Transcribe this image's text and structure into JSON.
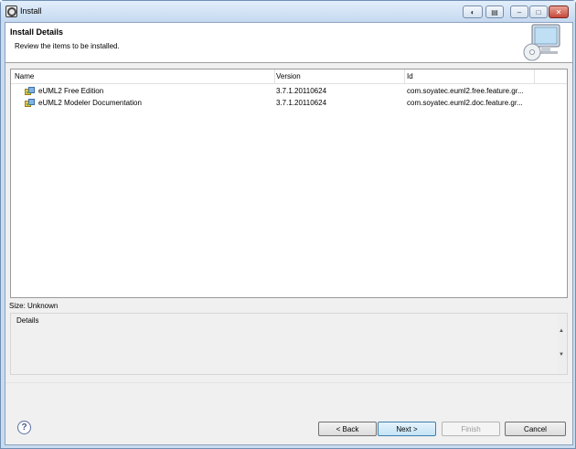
{
  "window": {
    "title": "Install"
  },
  "header": {
    "title": "Install Details",
    "subtitle": "Review the items to be installed."
  },
  "table": {
    "columns": [
      "Name",
      "Version",
      "Id"
    ],
    "rows": [
      {
        "name": "eUML2 Free Edition",
        "version": "3.7.1.20110624",
        "id": "com.soyatec.euml2.free.feature.gr..."
      },
      {
        "name": "eUML2 Modeler Documentation",
        "version": "3.7.1.20110624",
        "id": "com.soyatec.euml2.doc.feature.gr..."
      }
    ]
  },
  "size_text": "Size: Unknown",
  "details": {
    "label": "Details"
  },
  "buttons": {
    "back": "< Back",
    "next": "Next >",
    "finish": "Finish",
    "cancel": "Cancel",
    "help": "?"
  },
  "icons": {
    "window": "eclipse-icon",
    "header": "monitor-cd-icon",
    "feature": "feature-plugin-icon"
  }
}
